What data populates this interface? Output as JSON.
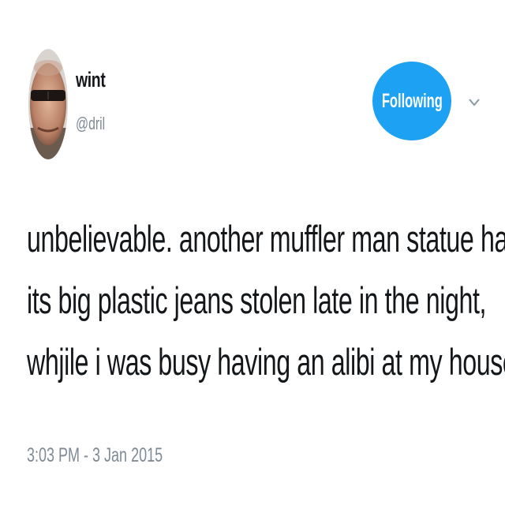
{
  "user": {
    "name": "wint",
    "handle": "@dril"
  },
  "follow_button": {
    "label": "Following",
    "color": "#1da1f2"
  },
  "menu": {
    "icon": "chevron-down-icon"
  },
  "tweet": {
    "lines": [
      "unbelievable. another muffler man statue had",
      "its big plastic jeans stolen late in the night,",
      "whjile i was busy having an alibi at my house"
    ],
    "timestamp": "3:03 PM - 3 Jan 2015"
  }
}
